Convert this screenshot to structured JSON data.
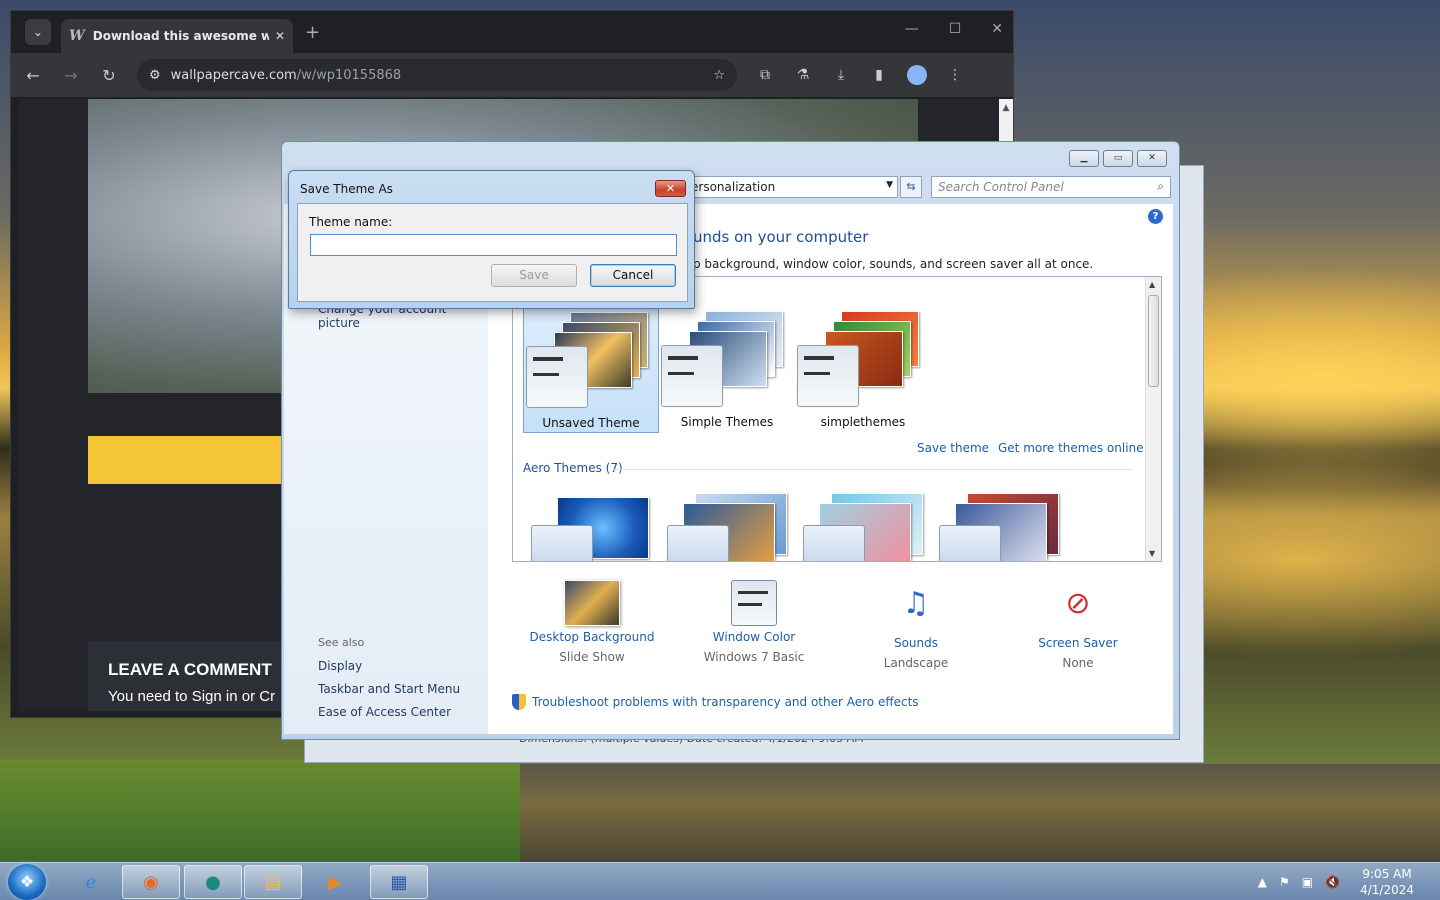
{
  "browser": {
    "tab_title": "Download this awesome wallp",
    "tab_favicon": "W",
    "url_domain": "wallpapercave.com",
    "url_path": "/w/wp10155868",
    "page": {
      "comment_heading": "LEAVE A COMMENT",
      "comment_sub": "You need to Sign in or Cr"
    }
  },
  "behind_window": {
    "details_text": "Dimensions: (multiple values)       Date created: 4/1/2024 9:05 AM"
  },
  "control_panel": {
    "address": "ersonalization",
    "search_placeholder": "Search Control Panel",
    "heading": "unds on your computer",
    "description": "p background, window color, sounds, and screen saver all at once.",
    "left_links": {
      "account_picture": "Change your account picture",
      "see_also": "See also",
      "display": "Display",
      "taskbar": "Taskbar and Start Menu",
      "ease": "Ease of Access Center"
    },
    "my_themes": [
      {
        "name": "Unsaved Theme",
        "selected": true
      },
      {
        "name": "Simple Themes",
        "selected": false
      },
      {
        "name": "simplethemes",
        "selected": false
      }
    ],
    "save_theme_link": "Save theme",
    "more_themes_link": "Get more themes online",
    "aero_section": "Aero Themes (7)",
    "bottom_items": [
      {
        "label": "Desktop Background",
        "value": "Slide Show"
      },
      {
        "label": "Window Color",
        "value": "Windows 7 Basic"
      },
      {
        "label": "Sounds",
        "value": "Landscape"
      },
      {
        "label": "Screen Saver",
        "value": "None"
      }
    ],
    "troubleshoot_link": "Troubleshoot problems with transparency and other Aero effects"
  },
  "dialog": {
    "title": "Save Theme As",
    "field_label": "Theme name:",
    "field_value": "",
    "save_button": "Save",
    "cancel_button": "Cancel"
  },
  "taskbar": {
    "time": "9:05 AM",
    "date": "4/1/2024"
  },
  "colors": {
    "link_blue": "#1e5fa9",
    "heading_blue": "#1e4e9a",
    "chrome_dark": "#1f2023"
  }
}
